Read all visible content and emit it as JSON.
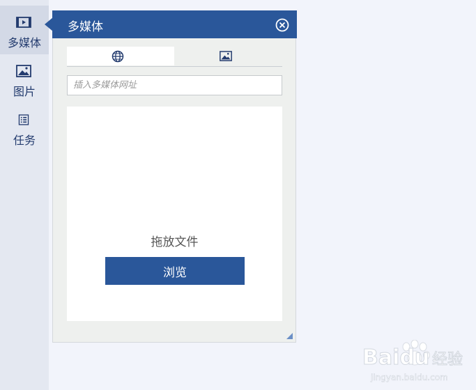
{
  "sidebar": {
    "items": [
      {
        "label": "多媒体",
        "icon": "video-icon",
        "active": true
      },
      {
        "label": "图片",
        "icon": "image-icon",
        "active": false
      },
      {
        "label": "任务",
        "icon": "task-list-icon",
        "active": false
      }
    ]
  },
  "panel": {
    "title": "多媒体",
    "close_icon": "close-circle-icon",
    "tabs": [
      {
        "icon": "globe-icon",
        "selected": true
      },
      {
        "icon": "image-icon",
        "selected": false
      }
    ],
    "url_input": {
      "placeholder": "插入多媒体网址",
      "value": ""
    },
    "drop_zone": {
      "text": "拖放文件",
      "browse_label": "浏览"
    }
  },
  "watermark": {
    "brand": "Baidu",
    "cn": "经验",
    "url": "jingyan.baidu.com"
  },
  "colors": {
    "accent": "#2a579a",
    "sidebar_bg": "#e4e8f1",
    "page_bg": "#f2f4fb"
  }
}
